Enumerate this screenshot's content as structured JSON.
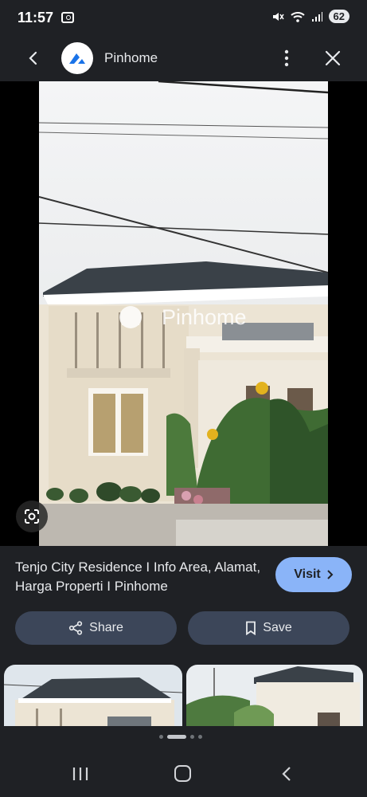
{
  "status_bar": {
    "time": "11:57",
    "battery": "62"
  },
  "top_bar": {
    "site_name": "Pinhome"
  },
  "image": {
    "watermark": "Pinhome"
  },
  "result": {
    "title": "Tenjo City Residence I Info Area, Alamat, Harga Properti I Pinhome",
    "visit_label": "Visit"
  },
  "actions": {
    "share_label": "Share",
    "save_label": "Save"
  },
  "colors": {
    "accent": "#8ab4f8",
    "background": "#1f2125",
    "chip": "#3c4659"
  }
}
